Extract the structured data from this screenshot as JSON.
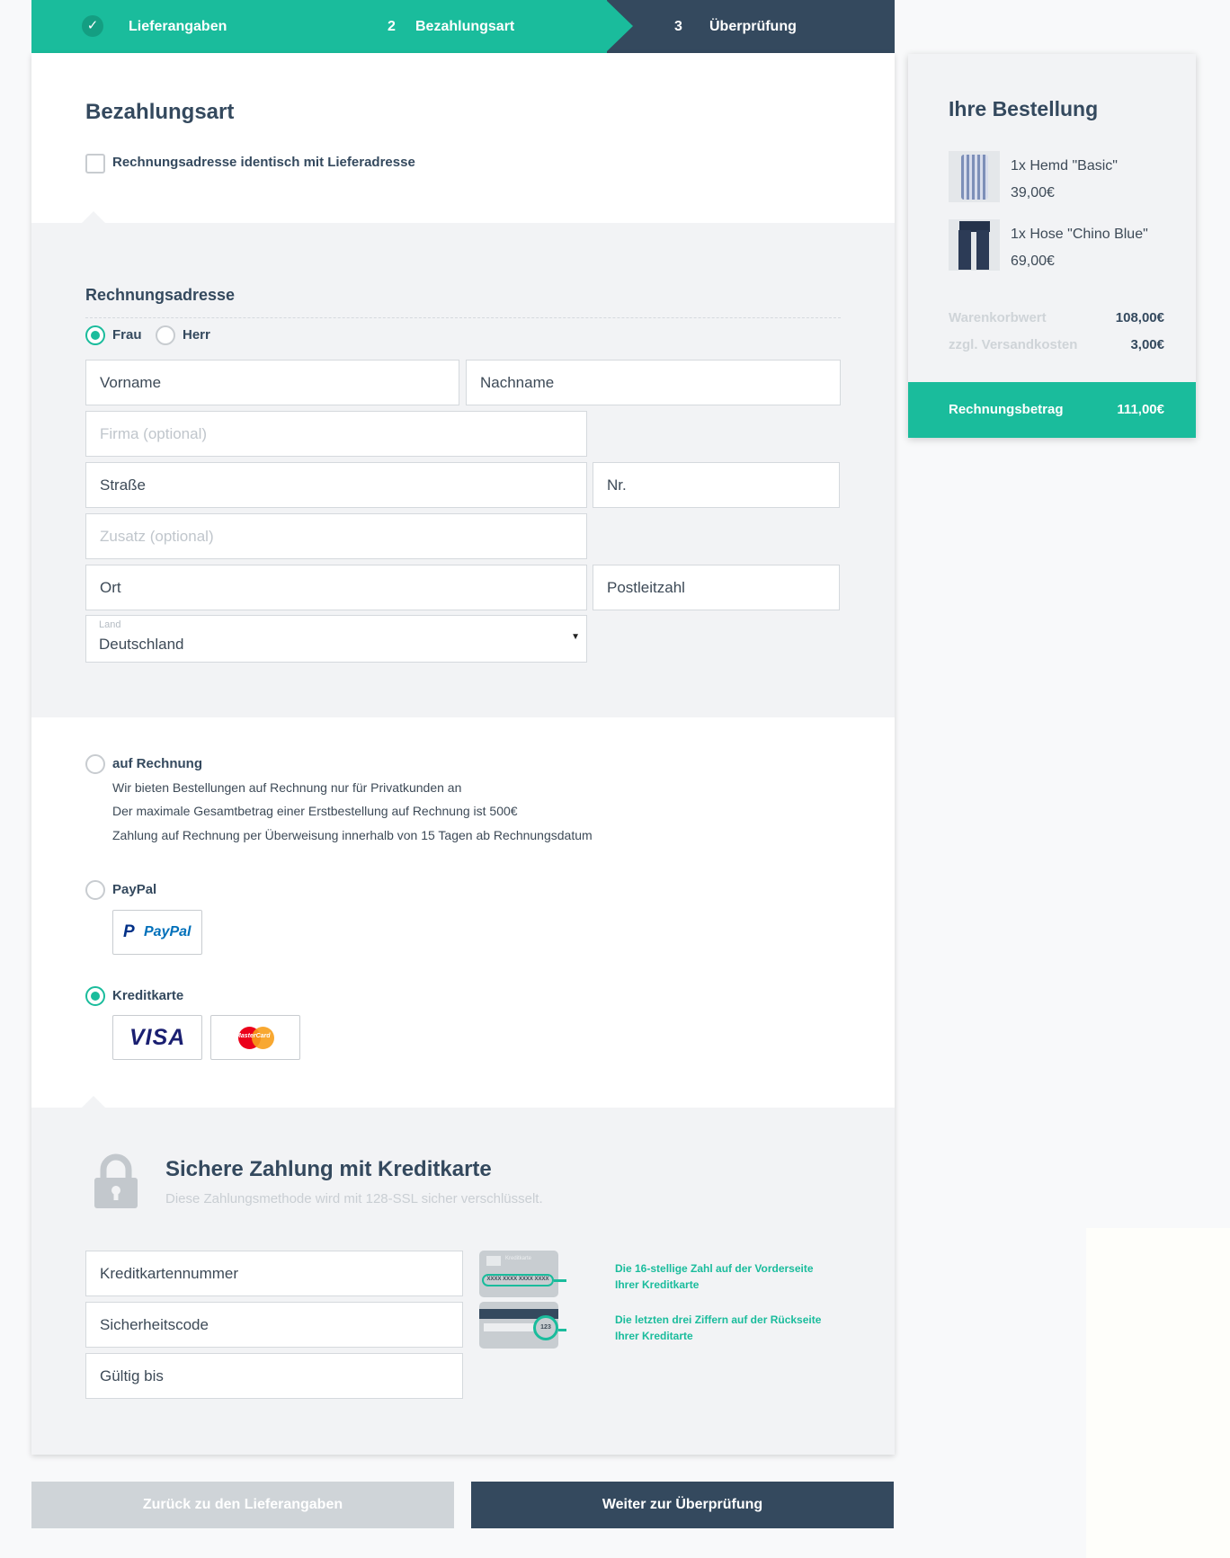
{
  "stepper": {
    "step1": {
      "label": "Lieferangaben"
    },
    "step2": {
      "number": "2",
      "label": "Bezahlungsart"
    },
    "step3": {
      "number": "3",
      "label": "Überprüfung"
    }
  },
  "payment_section": {
    "title": "Bezahlungsart",
    "same_address_label": "Rechnungsadresse identisch mit Lieferadresse"
  },
  "billing": {
    "title": "Rechnungsadresse",
    "salutation": {
      "frau": "Frau",
      "herr": "Herr"
    },
    "vorname": "Vorname",
    "nachname": "Nachname",
    "firma": "Firma (optional)",
    "strasse": "Straße",
    "nr": "Nr.",
    "zusatz": "Zusatz (optional)",
    "ort": "Ort",
    "plz": "Postleitzahl",
    "land_label": "Land",
    "land_value": "Deutschland"
  },
  "methods": {
    "invoice": {
      "label": "auf Rechnung",
      "line1": "Wir bieten Bestellungen auf Rechnung nur für Privatkunden an",
      "line2": "Der maximale Gesamtbetrag einer Erstbestellung auf Rechnung ist 500€",
      "line3": "Zahlung auf Rechnung per Überweisung innerhalb von 15 Tagen ab Rechnungsdatum"
    },
    "paypal": {
      "label": "PayPal",
      "logo_text": "PayPal"
    },
    "creditcard": {
      "label": "Kreditkarte",
      "visa_text": "VISA",
      "mastercard_text": "MasterCard"
    }
  },
  "secure": {
    "title": "Sichere Zahlung mit Kreditkarte",
    "subtitle": "Diese Zahlungsmethode wird mit 128-SSL sicher verschlüsselt.",
    "card_number": "Kreditkartennummer",
    "security_code": "Sicherheitscode",
    "valid_until": "Gültig bis",
    "card_front_label": "Kreditkarte",
    "card_front_digits": "XXXX XXXX XXXX XXXX",
    "card_back_digits": "123",
    "hint1_line1": "Die 16-stellige Zahl auf der Vorderseite",
    "hint1_line2": "Ihrer Kreditkarte",
    "hint2_line1": "Die letzten drei Ziffern auf der Rückseite",
    "hint2_line2": "Ihrer Kreditarte"
  },
  "order": {
    "title": "Ihre Bestellung",
    "items": [
      {
        "name": "1x Hemd \"Basic\"",
        "price": "39,00€"
      },
      {
        "name": "1x Hose \"Chino Blue\"",
        "price": "69,00€"
      }
    ],
    "subtotal_label": "Warenkorbwert",
    "subtotal_value": "108,00€",
    "shipping_label": "zzgl. Versandkosten",
    "shipping_value": "3,00€",
    "total_label": "Rechnungsbetrag",
    "total_value": "111,00€"
  },
  "buttons": {
    "back": "Zurück zu den Lieferangaben",
    "next": "Weiter zur Überprüfung"
  },
  "colors": {
    "accent": "#1abc9c",
    "dark": "#34495e",
    "muted": "#cfd4d8"
  }
}
